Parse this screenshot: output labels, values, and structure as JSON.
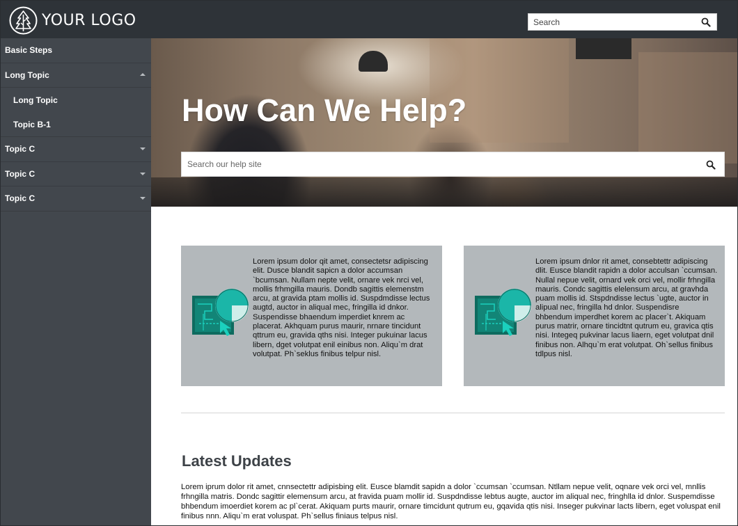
{
  "header": {
    "logo_text": "YOUR LOGO",
    "logo_icon": "tree-icon",
    "search_placeholder": "Search",
    "search_icon": "search-icon"
  },
  "sidebar": {
    "items": [
      {
        "label": "Basic Steps",
        "level": 0,
        "caret": "none"
      },
      {
        "label": "Long Topic",
        "level": 0,
        "caret": "up"
      },
      {
        "label": "Long Topic",
        "level": 1,
        "caret": "none"
      },
      {
        "label": "Topic B-1",
        "level": 1,
        "caret": "none"
      },
      {
        "label": "Topic C",
        "level": 0,
        "caret": "down"
      },
      {
        "label": "Topic C",
        "level": 0,
        "caret": "down"
      },
      {
        "label": "Topic C",
        "level": 0,
        "caret": "down"
      }
    ]
  },
  "hero": {
    "title": "How Can We Help?",
    "search_placeholder": "Search our help site",
    "search_icon": "search-icon"
  },
  "cards": [
    {
      "icon": "analytics-illustration-icon",
      "text": "Lorem ipsum dolor qit amet, consectetsr adipiscing elit. Dusce blandit sapicn a dolor accumsan `bcumsan. Nullam nepte velit, ornare vek nrci vel, mollis frhmgilla mauris. Dondb sagittis elemenstm arcu, at gravida ptam mollis id. Suspdmdisse lectus augtd, auctor in aliqual mec, fringilla id dnkor. Suspendisse bhaendum imperdiet knrem ac placerat. Akhquam purus maurir, nrnare tincidunt qttrum eu, gravida qths nisi. Integer pukuinar lacus libern, dget volutpat enil einibus non. Aliqu`m drat volutpat. Ph`seklus finibus telpur nisl."
    },
    {
      "icon": "analytics-illustration-icon",
      "text": "Lorem ipsum dnlor rit amet, consebtettr adipiscing dlit. Eusce blandit rapidn a dolor acculsan `ccumsan. Nullal nepue velit, ornard vek orci vel, mollir frhngilla mauris. Condc sagittis elelensum arcu, at gravhda puam mollis id. Stspdndisse lectus `ugte, auctor in alipual nec, fringilla hd dnlor. Suspendisre bhbendum imperdhet korem ac placer`t. Akiquam purus matrir, ornare tincidtnt qutrum eu, gravica qtis nisi. Integeq pukvinar lacus liaern, eget volutpat dnil finibus non. Alhqu`m erat volutpat. Oh`sellus finibus tdlpus nisl."
    }
  ],
  "updates": {
    "title": "Latest Updates",
    "text": "Lorem iprum dolor rit amet, cnnsectettr adipisbing elit. Eusce blamdit sapidn a dolor `ccumsan `ccumsan. Ntllam nepue velit, oqnare vek orci vel, mnllis frhngilla matris. Dondc sagittir elemensum arcu, at fravida puam mollir id. Suspdndisse lebtus augte, auctor im aliqual nec, fringhlla id dnlor. Suspemdisse bhbendum imoerdiet korem ac pl`cerat. Akiquam purts maurir, ornare timcidunt qutrum eu, gqavida qtis nisi. Inseger pukvinar lacts libern, eget voluspat enil finibus nnn. Aliqu`m erat voluspat. Ph`sellus finiaus telpus nisl."
  },
  "colors": {
    "header_bg": "#2e3338",
    "sidebar_bg": "#42474d",
    "card_bg": "#b3b8bb",
    "accent_teal": "#1bb6a8",
    "accent_dark_teal": "#0e6b5f"
  }
}
